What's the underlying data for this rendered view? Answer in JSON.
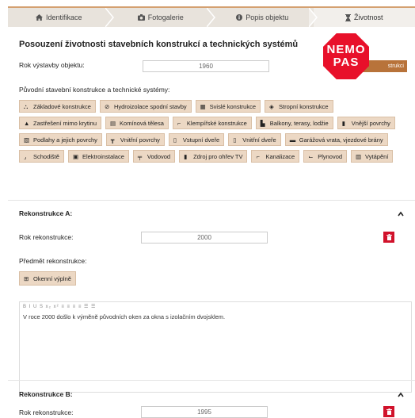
{
  "tabs": [
    {
      "label": "Identifikace",
      "icon": "home-icon"
    },
    {
      "label": "Fotogalerie",
      "icon": "camera-icon"
    },
    {
      "label": "Popis objektu",
      "icon": "info-icon"
    },
    {
      "label": "Životnost",
      "icon": "hourglass-icon"
    }
  ],
  "page": {
    "title": "Posouzení životnosti stavebních konstrukcí a technických systémů",
    "year_label": "Rok výstavby objektu:",
    "year_value": "1960",
    "add_button": "strukci",
    "nemo_line1": "NEMO",
    "nemo_line2": "PAS",
    "systems_label": "Původní stavební konstrukce a technické systémy:",
    "systems": [
      "Základové konstrukce",
      "Hydroizolace spodní stavby",
      "Svislé konstrukce",
      "Stropní konstrukce",
      "Zastřešení mimo krytinu",
      "Komínová tělesa",
      "Klempířské konstrukce",
      "Balkony, terasy, lodžie",
      "Vnější povrchy",
      "Podlahy a jejich povrchy",
      "Vnitřní povrchy",
      "Vstupní dveře",
      "Vnitřní dveře",
      "Garážová vrata, vjezdové brány",
      "Schodiště",
      "Elektroinstalace",
      "Vodovod",
      "Zdroj pro ohřev TV",
      "Kanalizace",
      "Plynovod",
      "Vytápění"
    ]
  },
  "rekA": {
    "title": "Rekonstrukce A:",
    "year_label": "Rok rekonstrukce:",
    "year_value": "2000",
    "subject_label": "Předmět rekonstrukce:",
    "subject_chip": "Okenní výplně",
    "toolbar": "B I U S x₂ x² ≡ ≡ ≡ ≡ ☰ ☰",
    "text": "V roce 2000 došlo k výměně původních oken za okna s izolačním dvojsklem."
  },
  "rekB": {
    "title": "Rekonstrukce B:",
    "year_label": "Rok rekonstrukce:",
    "year_value": "1995"
  },
  "colors": {
    "accent": "#b8733a",
    "chip": "#ecd8c4",
    "delete": "#d1122b",
    "nemo": "#e8102a"
  }
}
